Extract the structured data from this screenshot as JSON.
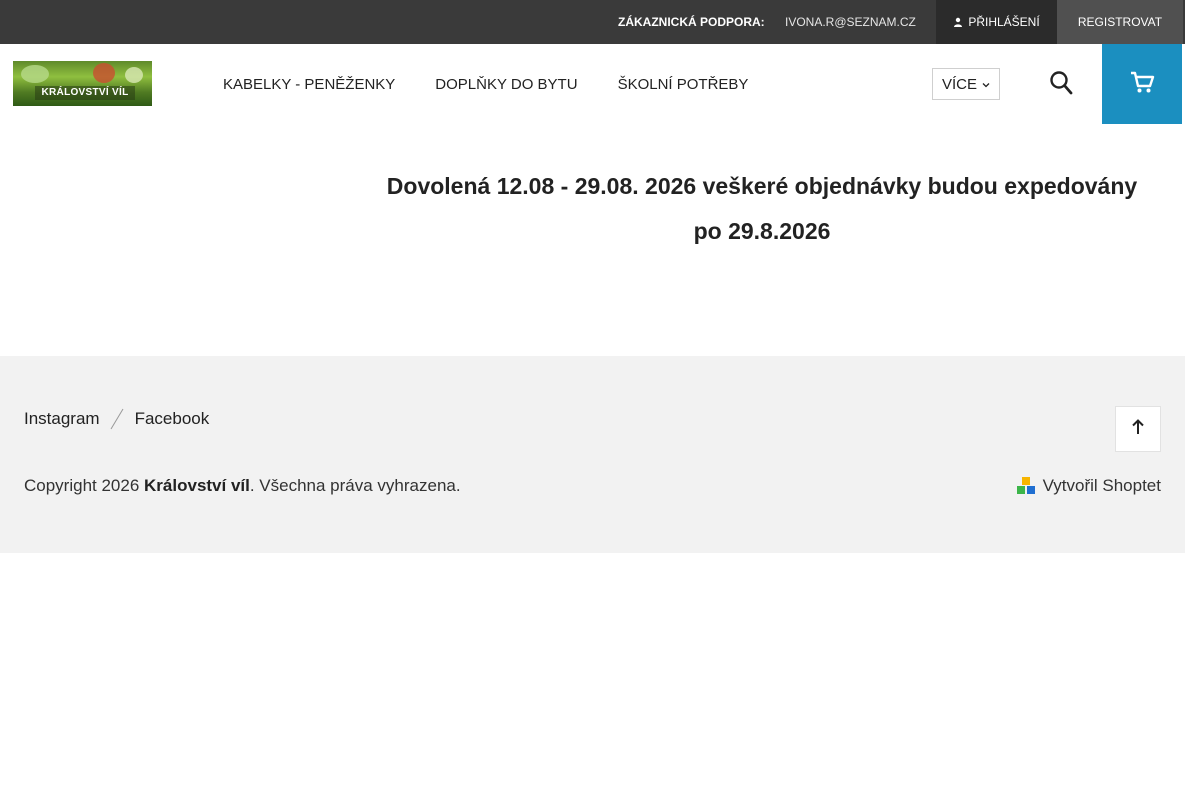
{
  "topbar": {
    "support_label": "Zákaznická podpora:",
    "support_email": "ivona.r@seznam.cz",
    "login_label": "Přihlášení",
    "register_label": "Registrovat"
  },
  "header": {
    "logo_text": "KRÁLOVSTVÍ VÍL",
    "nav_items": [
      "Kabelky - peněženky",
      "Doplňky do bytu",
      "Školní potřeby"
    ],
    "more_label": "Více"
  },
  "notice": {
    "line1": "Dovolená 12.08 - 29.08. 2026 veškeré objednávky budou expedovány",
    "line2": "po 29.8.2026"
  },
  "footer": {
    "social": [
      "Instagram",
      "Facebook"
    ],
    "copyright_prefix": "Copyright 2026",
    "copyright_brand": "Království víl",
    "copyright_suffix": ". Všechna práva vyhrazena.",
    "shoptet_label": "Vytvořil Shoptet"
  },
  "colors": {
    "topbar_bg": "#3a3a3a",
    "cart_accent": "#1b8fc0",
    "footer_bg": "#f2f2f2"
  },
  "icons": {
    "login": "user-icon",
    "more": "chevron-down-icon",
    "search": "search-icon",
    "cart": "cart-icon",
    "back_to_top": "arrow-up-icon",
    "shoptet": "shoptet-logo-icon"
  }
}
